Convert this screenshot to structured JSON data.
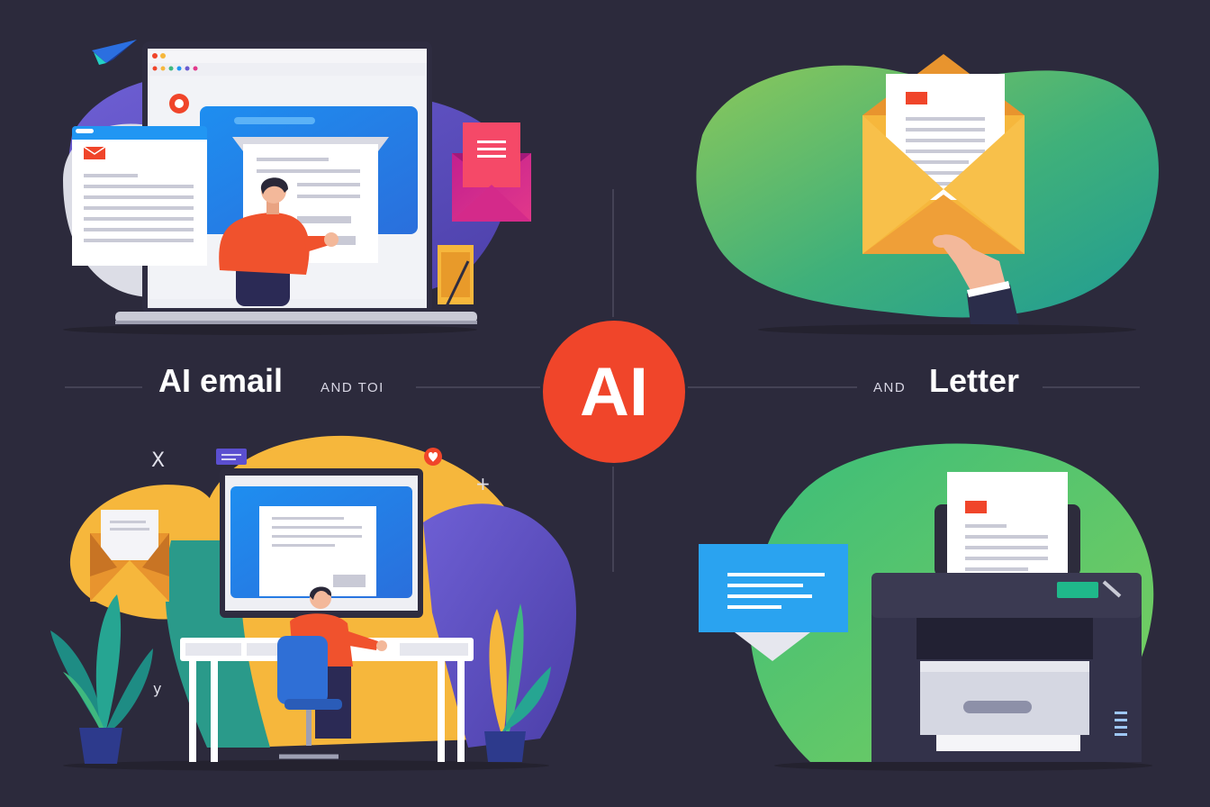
{
  "badge": {
    "label": "AI"
  },
  "captions": {
    "left_title": "AI email",
    "left_small": "AND TOI",
    "right_small": "AND",
    "right_title": "Letter"
  },
  "colors": {
    "background": "#2c2a3c",
    "badge": "#f0452a",
    "accent_blue": "#2196f3",
    "accent_green": "#3fb87f",
    "accent_yellow": "#f6b73c",
    "accent_purple": "#6a5bd0",
    "accent_red": "#f0452a"
  },
  "icons": [
    "paper-plane-icon",
    "laptop-icon",
    "envelope-icon",
    "letter-icon",
    "person-icon",
    "desktop-monitor-icon",
    "desk-chair-icon",
    "plant-icon",
    "printer-icon",
    "chat-bubble-icon",
    "heart-icon",
    "hand-icon"
  ]
}
